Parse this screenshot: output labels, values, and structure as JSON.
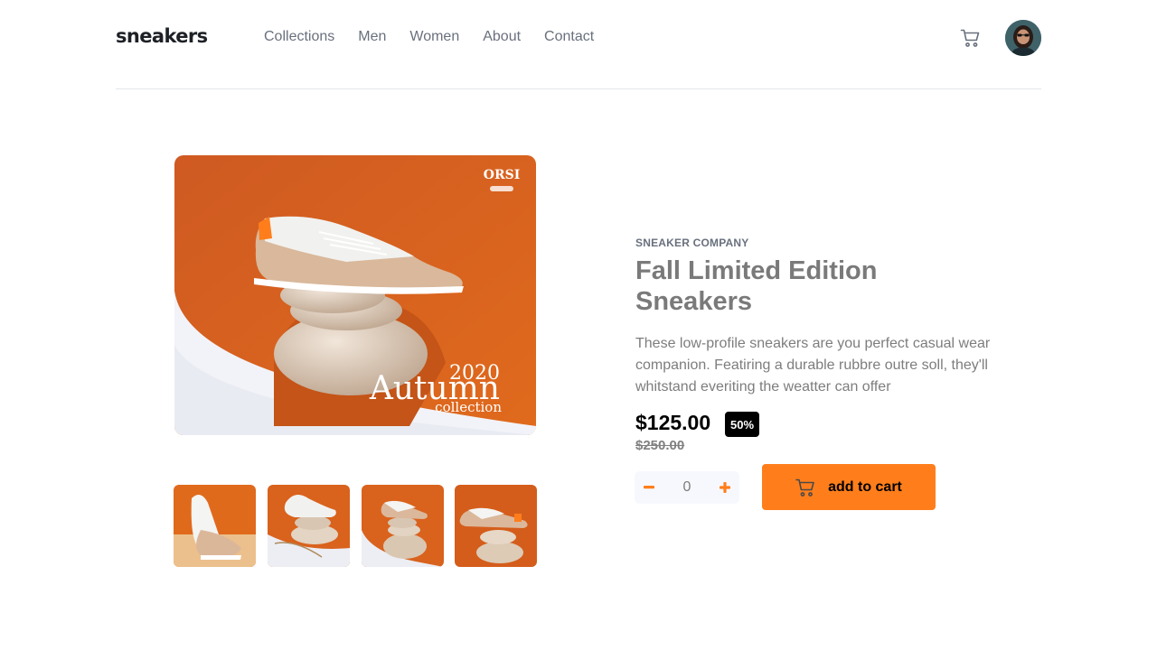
{
  "header": {
    "logo": "sneakers",
    "nav": [
      "Collections",
      "Men",
      "Women",
      "About",
      "Contact"
    ],
    "cart_icon": "cart-icon",
    "avatar_icon": "user-avatar"
  },
  "gallery": {
    "main_image": {
      "brand": "ORSI",
      "year": "2020",
      "headline": "Autumn",
      "subline": "collection"
    },
    "thumbnails": [
      "thumbnail-1",
      "thumbnail-2",
      "thumbnail-3",
      "thumbnail-4"
    ]
  },
  "product": {
    "company": "SNEAKER COMPANY",
    "title": "Fall Limited Edition Sneakers",
    "description": "These low-profile sneakers are you perfect casual wear companion. Featiring a durable rubbre outre soll, they'll whitstand everiting the weatter can offer",
    "price": "$125.00",
    "discount": "50%",
    "old_price": "$250.00",
    "quantity": "0",
    "add_to_cart": "add to cart"
  },
  "colors": {
    "accent": "#ff7e1b",
    "text_dark": "#1d2025",
    "text_muted": "#69707d",
    "badge_bg": "#000000"
  }
}
